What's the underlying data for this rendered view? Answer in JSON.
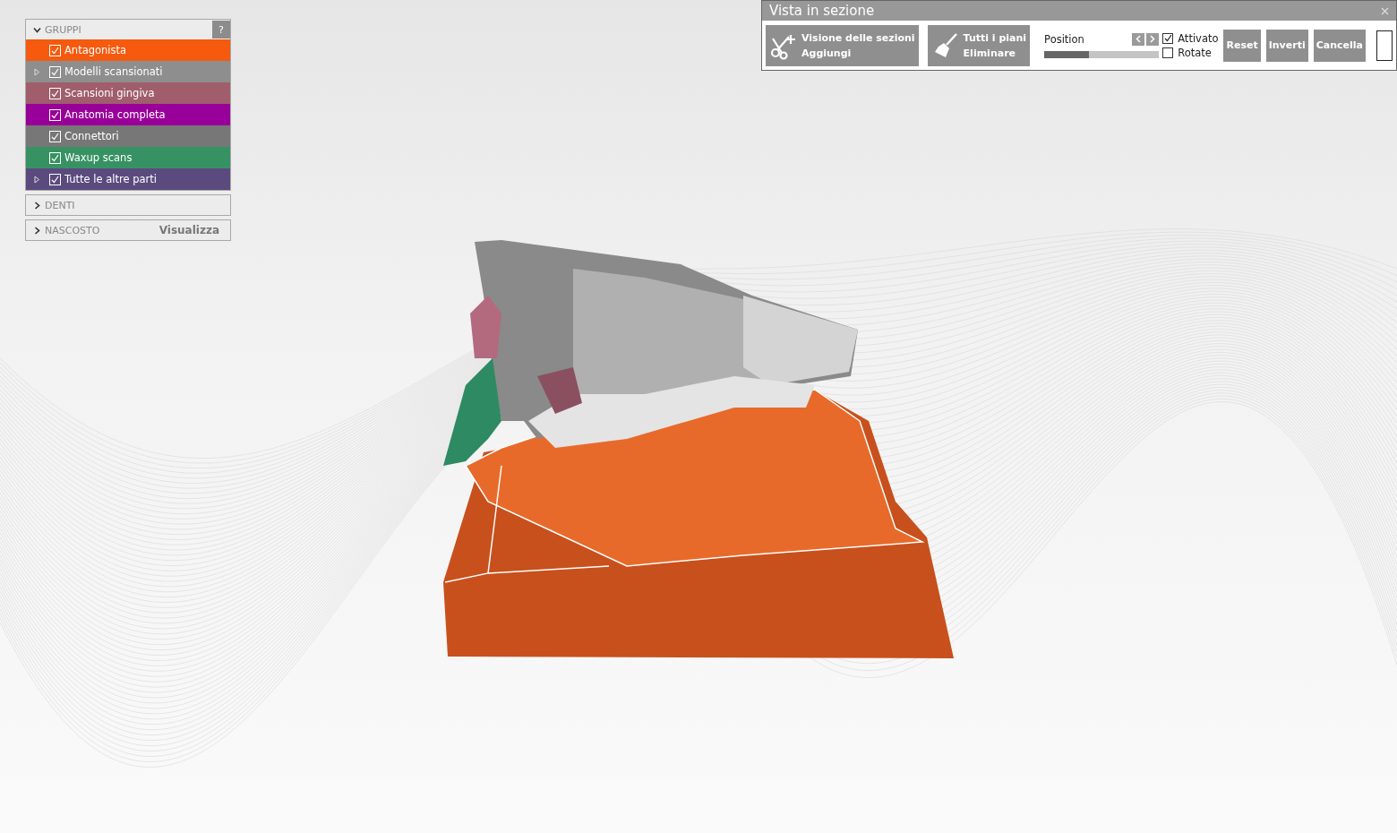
{
  "groups_panel": {
    "sections": [
      {
        "title": "GRUPPI",
        "expanded": true,
        "help": "?",
        "items": [
          {
            "label": "Antagonista",
            "checked": true,
            "color": "#f55a0f",
            "kind": "item"
          },
          {
            "label": "Modelli scansionati",
            "checked": true,
            "color": "#8e8e8e",
            "kind": "folder"
          },
          {
            "label": "Scansioni gingiva",
            "checked": true,
            "color": "#a05d6c",
            "kind": "item"
          },
          {
            "label": "Anatomia completa",
            "checked": true,
            "color": "#990099",
            "kind": "item"
          },
          {
            "label": "Connettori",
            "checked": true,
            "color": "#777777",
            "kind": "item"
          },
          {
            "label": "Waxup scans",
            "checked": true,
            "color": "#379263",
            "kind": "item"
          },
          {
            "label": "Tutte le altre parti",
            "checked": true,
            "color": "#5b4a7e",
            "kind": "folder"
          }
        ]
      },
      {
        "title": "DENTI",
        "expanded": false
      },
      {
        "title": "NASCOSTO",
        "expanded": false,
        "action": "Visualizza"
      }
    ]
  },
  "section_dialog": {
    "title": "Vista in sezione",
    "tool_buttons": [
      {
        "line1": "Visione delle sezioni",
        "line2": "Aggiungi",
        "disabled": true,
        "kind": "scissors"
      },
      {
        "line1": "Tutti i piani",
        "line2": "Eliminare",
        "disabled": true,
        "kind": "broom"
      }
    ],
    "position": {
      "label": "Position",
      "level": 0.39
    },
    "options": [
      {
        "label": "Attivato",
        "checked": true
      },
      {
        "label": "Rotate",
        "checked": false
      }
    ],
    "buttons": [
      {
        "label": "Reset",
        "disabled": true
      },
      {
        "label": "Inverti",
        "disabled": true
      },
      {
        "label": "Cancella",
        "disabled": true
      }
    ]
  }
}
